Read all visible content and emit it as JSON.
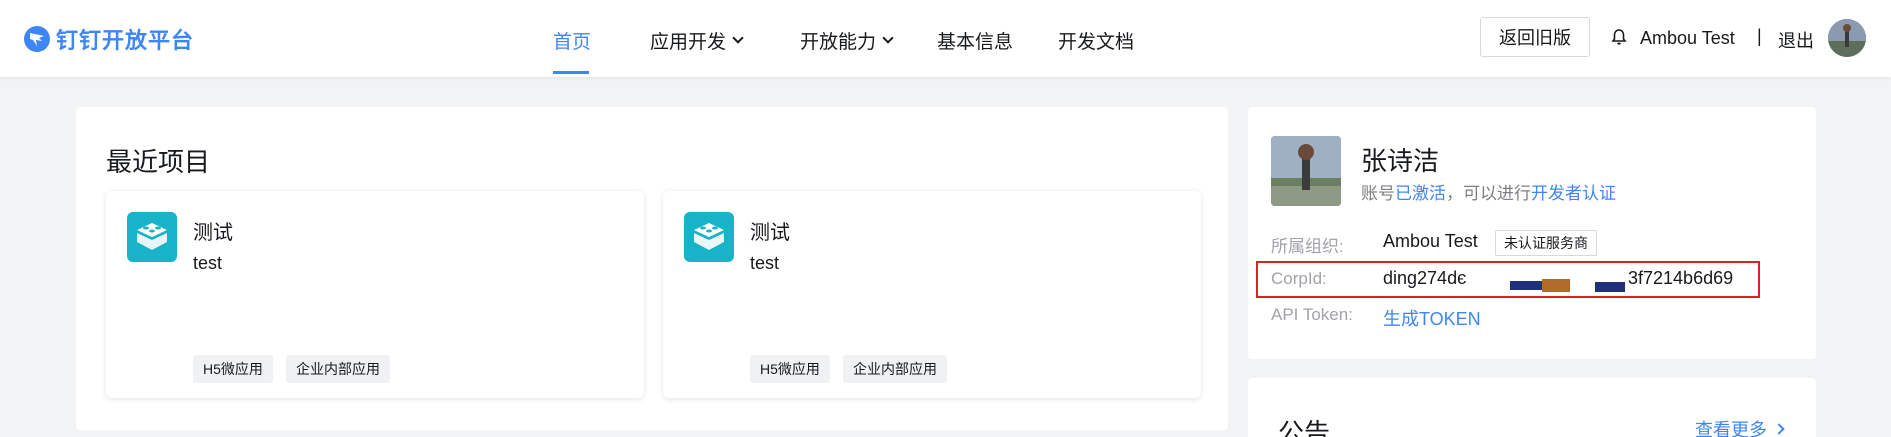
{
  "header": {
    "brand": "钉钉开放平台",
    "nav": [
      {
        "label": "首页",
        "active": true
      },
      {
        "label": "应用开发",
        "has_dropdown": true
      },
      {
        "label": "开放能力",
        "has_dropdown": true
      },
      {
        "label": "基本信息"
      },
      {
        "label": "开发文档"
      }
    ],
    "back_button": "返回旧版",
    "user_name": "Ambou Test",
    "separator": "|",
    "logout": "退出"
  },
  "recent": {
    "title": "最近项目",
    "projects": [
      {
        "name": "测试",
        "desc": "test",
        "tags": [
          "H5微应用",
          "企业内部应用"
        ]
      },
      {
        "name": "测试",
        "desc": "test",
        "tags": [
          "H5微应用",
          "企业内部应用"
        ]
      }
    ]
  },
  "profile": {
    "name": "张诗洁",
    "status_prefix": "账号",
    "status_active": "已激活",
    "status_mid": "，可以进行",
    "status_link": "开发者认证",
    "org_label": "所属组织:",
    "org_value": "Ambou Test",
    "org_badge": "未认证服务商",
    "corpid_label": "CorpId:",
    "corpid_start": "ding274dє",
    "corpid_end": "3f7214b6d69",
    "token_label": "API Token:",
    "token_link": "生成TOKEN"
  },
  "notice": {
    "title": "公告",
    "more": "查看更多"
  },
  "colors": {
    "accent": "#3e86f6",
    "project_icon": "#16b3c9",
    "highlight_box": "#e02020"
  }
}
